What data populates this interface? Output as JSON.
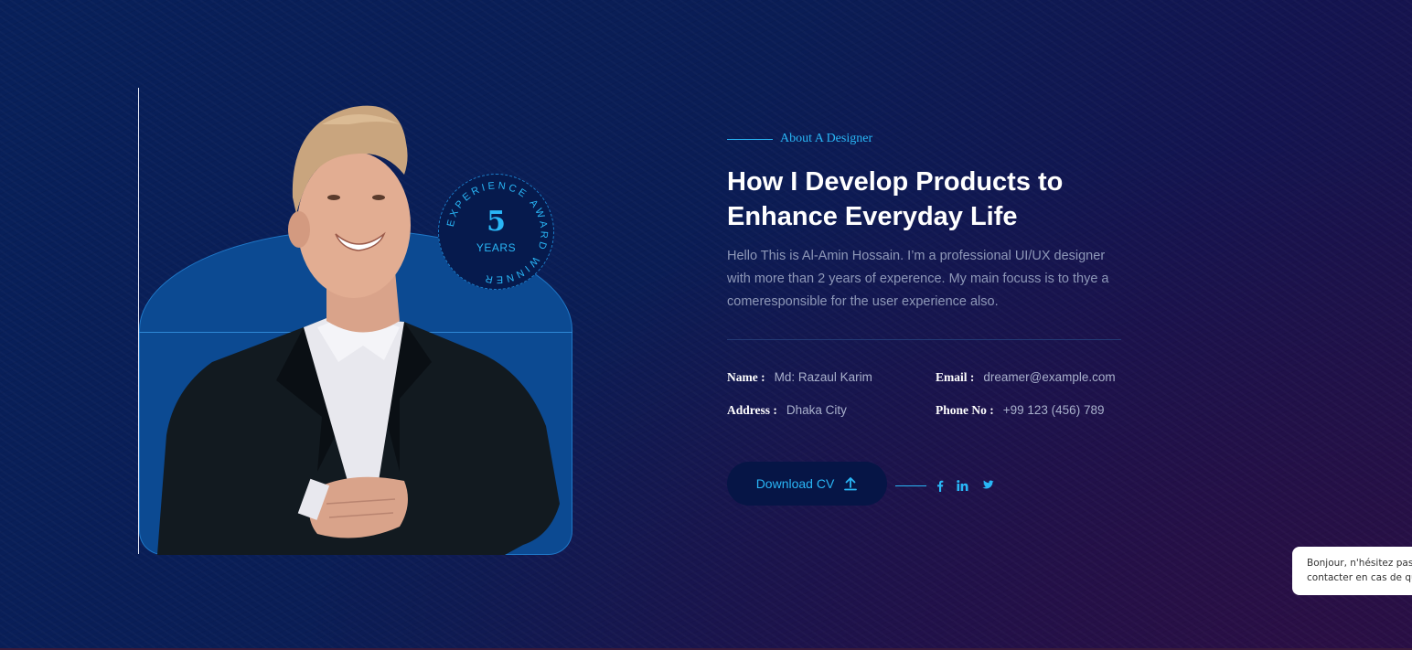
{
  "about": {
    "eyebrow": "About A Designer",
    "title_line1": "How I Develop Products to",
    "title_line2": "Enhance Everyday Life",
    "desc_line1": "Hello This is Al-Amin Hossain. I’m a professional UI/UX designer",
    "desc_line2": "with more than 2 years of experence. My main focuss is to thye a",
    "desc_line3": "comeresponsible for the user experience also."
  },
  "badge": {
    "number": "5",
    "unit": "YEARS",
    "ring_text": "EXPERIENCE AWARD WINNER"
  },
  "info": {
    "name_label": "Name :",
    "name_value": "Md: Razaul Karim",
    "email_label": "Email :",
    "email_value": "dreamer@example.com",
    "address_label": "Address :",
    "address_value": "Dhaka City",
    "phone_label": "Phone No :",
    "phone_value": "+99 123 (456) 789"
  },
  "cta": {
    "download_label": "Download CV",
    "download_icon": "upload-icon"
  },
  "social": [
    "facebook-icon",
    "linkedin-icon",
    "twitter-icon"
  ],
  "chat": {
    "line1": "Bonjour, n'hésitez pas",
    "line2": "contacter en cas de qu"
  },
  "colors": {
    "accent": "#29b6f6",
    "background": "#0a1d55",
    "arch": "#0c4a92",
    "button": "#061546"
  }
}
